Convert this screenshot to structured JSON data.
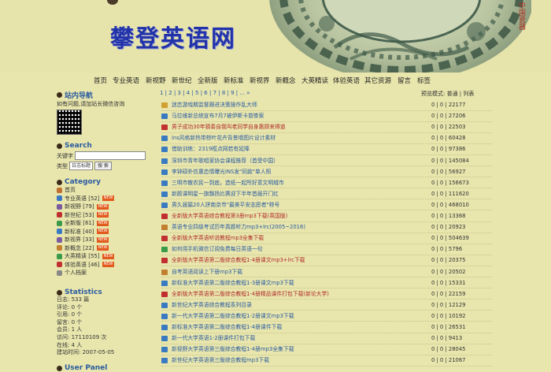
{
  "site": {
    "logo_text": "攀登英语网",
    "seal_text": "中国瓷器"
  },
  "nav": [
    "首页",
    "专业英语",
    "新视野",
    "新世纪",
    "全新版",
    "新标准",
    "新视界",
    "新概念",
    "大英精读",
    "体验英语",
    "其它资源",
    "留言",
    "标签"
  ],
  "sidebar": {
    "nav_section": {
      "title": "站内导航",
      "text": "如有问题,请加站长微信咨询"
    },
    "search": {
      "title": "Search",
      "keyword_label": "关键字",
      "type_label": "类型",
      "type_value": "日志标题",
      "button": "搜 索"
    },
    "category": {
      "title": "Category",
      "items": [
        {
          "label": "首页",
          "count": "",
          "color": "#c07030",
          "new": false
        },
        {
          "label": "专业英语 [52]",
          "count": "",
          "color": "#3a7ac0",
          "new": true
        },
        {
          "label": "新视野 [79]",
          "count": "",
          "color": "#7a5aa0",
          "new": true
        },
        {
          "label": "新世纪 [53]",
          "count": "",
          "color": "#c03030",
          "new": true
        },
        {
          "label": "全新版 [61]",
          "count": "",
          "color": "#3a9a4a",
          "new": true
        },
        {
          "label": "新标准 [40]",
          "count": "",
          "color": "#3a7ac0",
          "new": true
        },
        {
          "label": "新视界 [33]",
          "count": "",
          "color": "#7a5aa0",
          "new": true
        },
        {
          "label": "新概念 [22]",
          "count": "",
          "color": "#c08030",
          "new": true
        },
        {
          "label": "大英精读 [55]",
          "count": "",
          "color": "#3a9a4a",
          "new": true
        },
        {
          "label": "体验英语 [46]",
          "count": "",
          "color": "#c03030",
          "new": true
        },
        {
          "label": "个人档案",
          "count": "",
          "color": "#888888",
          "new": false
        }
      ]
    },
    "statistics": {
      "title": "Statistics",
      "lines": [
        "日志: 533 篇",
        "评论: 0 个",
        "引用: 0 个",
        "留言: 0 个",
        "会员: 1 人",
        "访问: 17110109 次",
        "在线: 4 人",
        "建站时间: 2007-05-05"
      ]
    },
    "user_panel": {
      "title": "User Panel"
    }
  },
  "list": {
    "pager": "1 | 2 | 3 | 4 | 5 | 6 | 7 | 8 | 9 | ... »",
    "right_label": "预览模式: 普通 | 列表",
    "rows": [
      {
        "title": "迷恋游戏期监督跟进决策操作乱大师",
        "stats": "0 | 0 | 22177",
        "icon": "#d0a030",
        "red": false
      },
      {
        "title": "马拉维新总统宣布7月7被伊斯卡普惨案",
        "stats": "0 | 0 | 27206",
        "icon": "#3a7ac0",
        "red": false
      },
      {
        "title": "男子成功30年猜奏自我叫老同学自身惠顾来得道",
        "stats": "0 | 0 | 22503",
        "icon": "#c03030",
        "red": true
      },
      {
        "title": "ins风格新热带棕叶花卉背景墙图片设计素材",
        "stats": "0 | 0 | 60428",
        "icon": "#3a7ac0",
        "red": false
      },
      {
        "title": "借助训练：2319框点网若有延降",
        "stats": "0 | 0 | 97386",
        "icon": "#3a7ac0",
        "red": false
      },
      {
        "title": "深圳市青年歌唱家协会课程推荐（首受中国）",
        "stats": "0 | 0 | 145084",
        "icon": "#3a7ac0",
        "red": false
      },
      {
        "title": "李钟硕朴信惠恋情曝光INS发\"同款\"单人照",
        "stats": "0 | 0 | 56927",
        "icon": "#3a7ac0",
        "red": false
      },
      {
        "title": "三明市散农民一到底，造纸一起所好意文明城市",
        "stats": "0 | 0 | 156673",
        "icon": "#3a7ac0",
        "red": false
      },
      {
        "title": "新题课明星一旗飘扬比赛迎下半年首届开门红",
        "stats": "0 | 0 | 111620",
        "icon": "#3a7ac0",
        "red": false
      },
      {
        "title": "男久届篇20人拼南京市\"最美平安志愿者\"称号",
        "stats": "0 | 0 | 468010",
        "icon": "#3a7ac0",
        "red": false
      },
      {
        "title": "全新版大学英语综合教程第3册mp3下载(英国版)",
        "stats": "0 | 0 | 13368",
        "icon": "#c03030",
        "red": true
      },
      {
        "title": "英语专业四级考试历年真题听力mp3+lrc(2005~2016)",
        "stats": "0 | 0 | 20923",
        "icon": "#c08030",
        "red": false
      },
      {
        "title": "全新版大学英语听说教程mp3全集下载",
        "stats": "0 | 0 | 504639",
        "icon": "#c03030",
        "red": true
      },
      {
        "title": "如何用手机微信订阅免费每日英语一句",
        "stats": "0 | 0 | 5796",
        "icon": "#3a9a4a",
        "red": false
      },
      {
        "title": "全新版大学英语第二版综合教程1-4册课文mp3+lrc下载",
        "stats": "0 | 0 | 20375",
        "icon": "#c03030",
        "red": true
      },
      {
        "title": "自考英语阅读上下册mp3下载",
        "stats": "0 | 0 | 20502",
        "icon": "#c08030",
        "red": false
      },
      {
        "title": "新标准大学英语第二版综合教程1-3册课文mp3下载",
        "stats": "0 | 0 | 15331",
        "icon": "#3a7ac0",
        "red": false
      },
      {
        "title": "全新版大学英语第二版综合教程1-4册精品课件打包下载(新论大学)",
        "stats": "0 | 0 | 22159",
        "icon": "#c03030",
        "red": true
      },
      {
        "title": "新世纪大学英语综合教程系列目录",
        "stats": "0 | 0 | 12129",
        "icon": "#3a7ac0",
        "red": false
      },
      {
        "title": "新一代大学英语第二版综合教程1-2册课文mp3下载",
        "stats": "0 | 0 | 10192",
        "icon": "#3a7ac0",
        "red": false
      },
      {
        "title": "新标准大学英语第二版综合教程1-4册课件下载",
        "stats": "0 | 0 | 26531",
        "icon": "#3a7ac0",
        "red": false
      },
      {
        "title": "新一代大学英语1-2册课件打包下载",
        "stats": "0 | 0 | 9413",
        "icon": "#3a7ac0",
        "red": false
      },
      {
        "title": "新视野大学英语第三版综合教程1-4册mp3全集下载",
        "stats": "0 | 0 | 28045",
        "icon": "#3a7ac0",
        "red": false
      },
      {
        "title": "新世纪大学英语第三版综合教程mp3下载",
        "stats": "0 | 0 | 21067",
        "icon": "#3a7ac0",
        "red": false
      }
    ]
  }
}
